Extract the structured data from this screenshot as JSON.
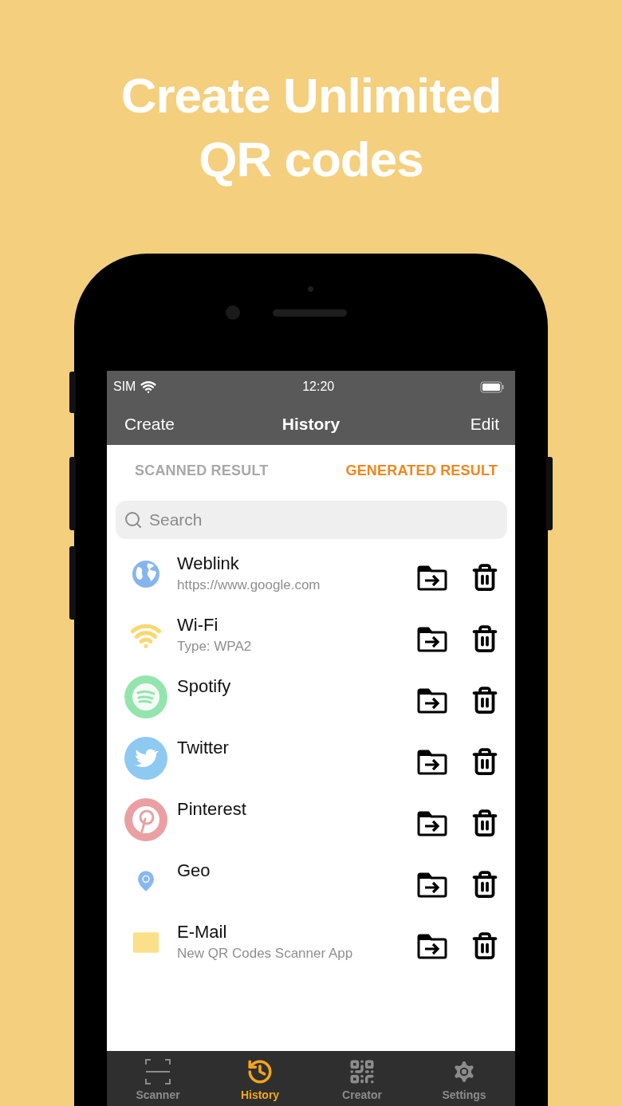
{
  "headline": "Create Unlimited QR codes",
  "status_bar": {
    "carrier": "SIM",
    "time": "12:20"
  },
  "nav_bar": {
    "left": "Create",
    "title": "History",
    "right": "Edit"
  },
  "segments": [
    {
      "label": "SCANNED RESULT",
      "selected": false
    },
    {
      "label": "GENERATED RESULT",
      "selected": true
    }
  ],
  "search": {
    "placeholder": "Search"
  },
  "rows": [
    {
      "kind": "weblink",
      "title": "Weblink",
      "subtitle": "https://www.google.com"
    },
    {
      "kind": "wifi",
      "title": "Wi-Fi",
      "subtitle": "Type: WPA2"
    },
    {
      "kind": "spotify",
      "title": "Spotify"
    },
    {
      "kind": "twitter",
      "title": "Twitter"
    },
    {
      "kind": "pinterest",
      "title": "Pinterest"
    },
    {
      "kind": "geo",
      "title": "Geo"
    },
    {
      "kind": "email",
      "title": "E-Mail",
      "subtitle": "New QR Codes Scanner App"
    }
  ],
  "tab_bar": [
    {
      "kind": "scanner",
      "label": "Scanner",
      "selected": false
    },
    {
      "kind": "history",
      "label": "History",
      "selected": true
    },
    {
      "kind": "creator",
      "label": "Creator",
      "selected": false
    },
    {
      "kind": "settings",
      "label": "Settings",
      "selected": false
    }
  ]
}
